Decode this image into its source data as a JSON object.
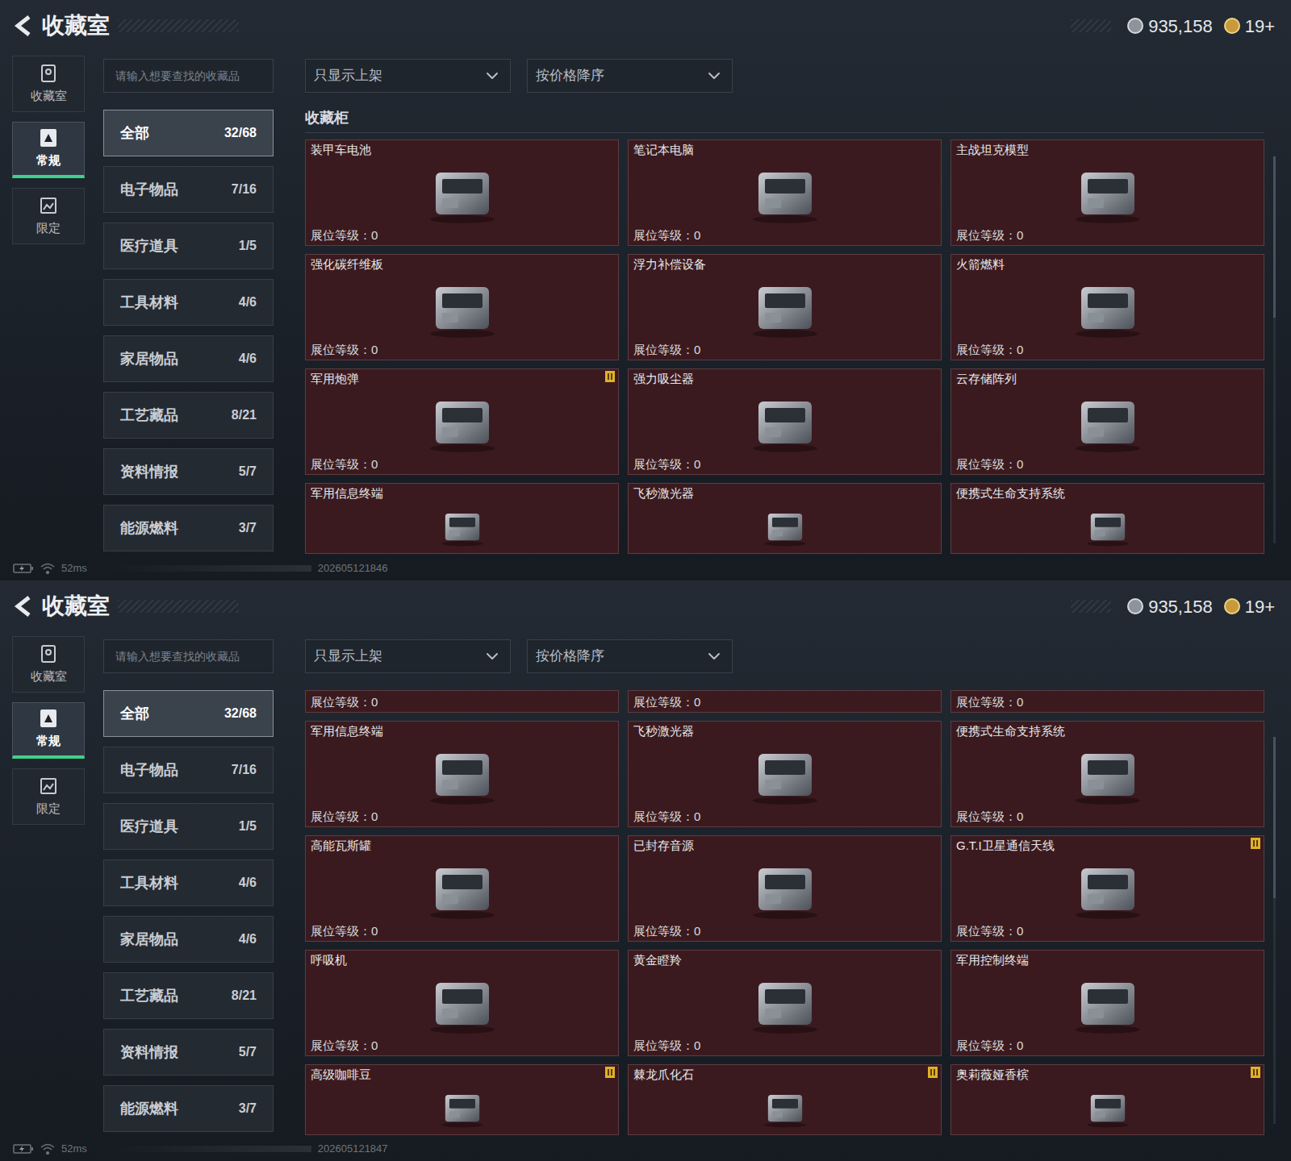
{
  "screens": [
    {
      "header": {
        "title": "收藏室",
        "currencies": [
          {
            "amount": "935,158",
            "kind": "silver"
          },
          {
            "amount": "19+",
            "kind": "gold"
          }
        ]
      },
      "nav": [
        {
          "label": "收藏室",
          "selected": false
        },
        {
          "label": "常规",
          "selected": true
        },
        {
          "label": "限定",
          "selected": false
        }
      ],
      "search": {
        "placeholder": "请输入想要查找的收藏品"
      },
      "filters": [
        "只显示上架",
        "按价格降序"
      ],
      "categories": [
        {
          "label": "全部",
          "count": "32/68",
          "selected": true
        },
        {
          "label": "电子物品",
          "count": "7/16",
          "selected": false
        },
        {
          "label": "医疗道具",
          "count": "1/5",
          "selected": false
        },
        {
          "label": "工具材料",
          "count": "4/6",
          "selected": false
        },
        {
          "label": "家居物品",
          "count": "4/6",
          "selected": false
        },
        {
          "label": "工艺藏品",
          "count": "8/21",
          "selected": false
        },
        {
          "label": "资料情报",
          "count": "5/7",
          "selected": false
        },
        {
          "label": "能源燃料",
          "count": "3/7",
          "selected": false
        }
      ],
      "section_title": "收藏柜",
      "cards": [
        {
          "name": "装甲车电池",
          "level": "展位等级：0",
          "kind": "full",
          "flagged": false
        },
        {
          "name": "笔记本电脑",
          "level": "展位等级：0",
          "kind": "full",
          "flagged": false
        },
        {
          "name": "主战坦克模型",
          "level": "展位等级：0",
          "kind": "full",
          "flagged": false
        },
        {
          "name": "强化碳纤维板",
          "level": "展位等级：0",
          "kind": "full",
          "flagged": false
        },
        {
          "name": "浮力补偿设备",
          "level": "展位等级：0",
          "kind": "full",
          "flagged": false
        },
        {
          "name": "火箭燃料",
          "level": "展位等级：0",
          "kind": "full",
          "flagged": false
        },
        {
          "name": "军用炮弹",
          "level": "展位等级：0",
          "kind": "full",
          "flagged": true
        },
        {
          "name": "强力吸尘器",
          "level": "展位等级：0",
          "kind": "full",
          "flagged": false
        },
        {
          "name": "云存储阵列",
          "level": "展位等级：0",
          "kind": "full",
          "flagged": false
        },
        {
          "name": "军用信息终端",
          "level": "",
          "kind": "cut_bottom",
          "flagged": false
        },
        {
          "name": "飞秒激光器",
          "level": "",
          "kind": "cut_bottom",
          "flagged": false
        },
        {
          "name": "便携式生命支持系统",
          "level": "",
          "kind": "cut_bottom",
          "flagged": false
        }
      ],
      "status_bar": {
        "ping": "52ms",
        "timestamp": "202605121846"
      }
    },
    {
      "header": {
        "title": "收藏室",
        "currencies": [
          {
            "amount": "935,158",
            "kind": "silver"
          },
          {
            "amount": "19+",
            "kind": "gold"
          }
        ]
      },
      "nav": [
        {
          "label": "收藏室",
          "selected": false
        },
        {
          "label": "常规",
          "selected": true
        },
        {
          "label": "限定",
          "selected": false
        }
      ],
      "search": {
        "placeholder": "请输入想要查找的收藏品"
      },
      "filters": [
        "只显示上架",
        "按价格降序"
      ],
      "categories": [
        {
          "label": "全部",
          "count": "32/68",
          "selected": true
        },
        {
          "label": "电子物品",
          "count": "7/16",
          "selected": false
        },
        {
          "label": "医疗道具",
          "count": "1/5",
          "selected": false
        },
        {
          "label": "工具材料",
          "count": "4/6",
          "selected": false
        },
        {
          "label": "家居物品",
          "count": "4/6",
          "selected": false
        },
        {
          "label": "工艺藏品",
          "count": "8/21",
          "selected": false
        },
        {
          "label": "资料情报",
          "count": "5/7",
          "selected": false
        },
        {
          "label": "能源燃料",
          "count": "3/7",
          "selected": false
        }
      ],
      "section_title": "",
      "cards": [
        {
          "name": "",
          "level": "展位等级：0",
          "kind": "cut_top",
          "flagged": false
        },
        {
          "name": "",
          "level": "展位等级：0",
          "kind": "cut_top",
          "flagged": false
        },
        {
          "name": "",
          "level": "展位等级：0",
          "kind": "cut_top",
          "flagged": false
        },
        {
          "name": "军用信息终端",
          "level": "展位等级：0",
          "kind": "full",
          "flagged": false
        },
        {
          "name": "飞秒激光器",
          "level": "展位等级：0",
          "kind": "full",
          "flagged": false
        },
        {
          "name": "便携式生命支持系统",
          "level": "展位等级：0",
          "kind": "full",
          "flagged": false
        },
        {
          "name": "高能瓦斯罐",
          "level": "展位等级：0",
          "kind": "full",
          "flagged": false
        },
        {
          "name": "已封存音源",
          "level": "展位等级：0",
          "kind": "full",
          "flagged": false
        },
        {
          "name": "G.T.I卫星通信天线",
          "level": "展位等级：0",
          "kind": "full",
          "flagged": true
        },
        {
          "name": "呼吸机",
          "level": "展位等级：0",
          "kind": "full",
          "flagged": false
        },
        {
          "name": "黄金瞪羚",
          "level": "展位等级：0",
          "kind": "full",
          "flagged": false
        },
        {
          "name": "军用控制终端",
          "level": "展位等级：0",
          "kind": "full",
          "flagged": false
        },
        {
          "name": "高级咖啡豆",
          "level": "",
          "kind": "cut_bottom",
          "flagged": true
        },
        {
          "name": "棘龙爪化石",
          "level": "",
          "kind": "cut_bottom",
          "flagged": true
        },
        {
          "name": "奥莉薇娅香槟",
          "level": "",
          "kind": "cut_bottom",
          "flagged": true
        }
      ],
      "status_bar": {
        "ping": "52ms",
        "timestamp": "202605121847"
      }
    }
  ]
}
